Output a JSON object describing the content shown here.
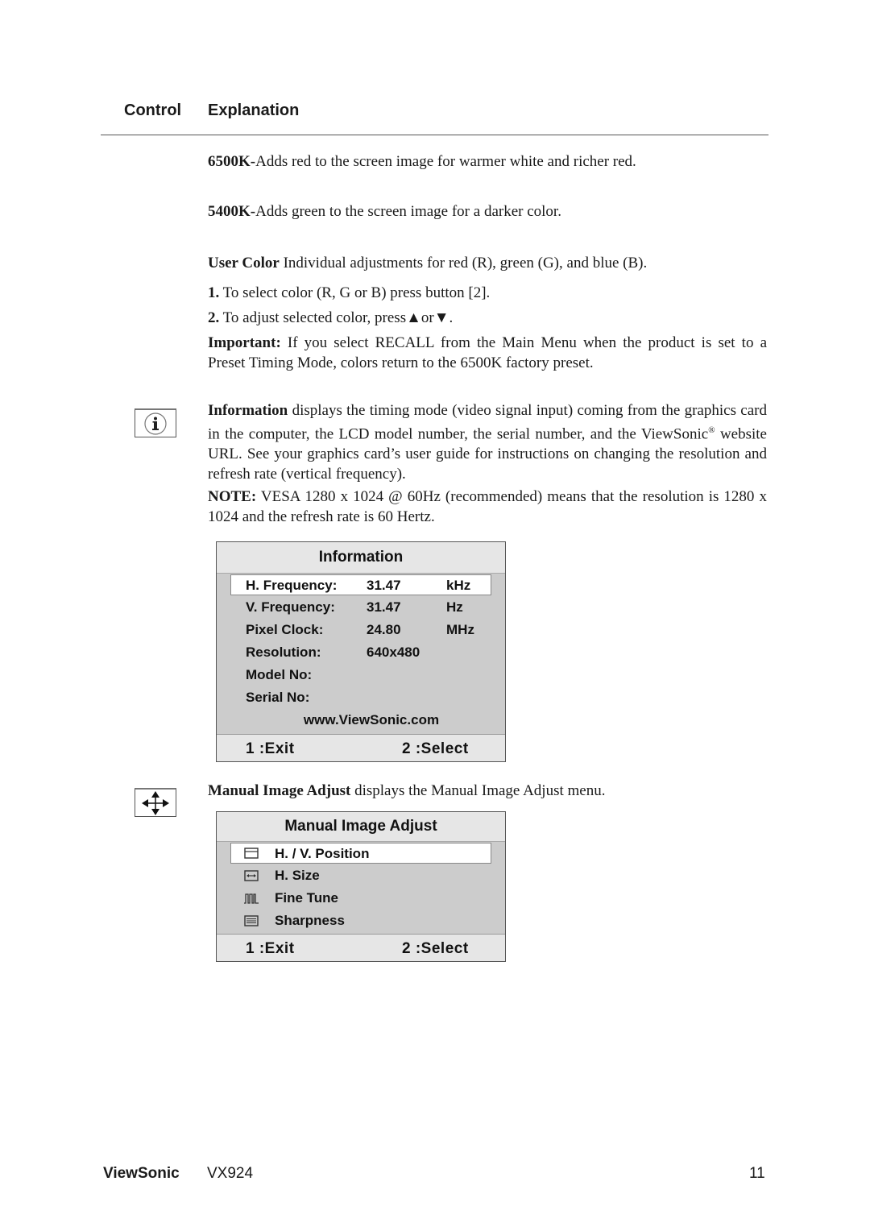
{
  "header": {
    "control": "Control",
    "explanation": "Explanation"
  },
  "color_temps": [
    {
      "key": "6500K-",
      "text": "Adds red to the screen image for warmer white and richer red."
    },
    {
      "key": "5400K-",
      "text": "Adds green to the screen image for a darker color."
    }
  ],
  "user_color": {
    "key": "User Color",
    "text": " Individual adjustments for red (R), green (G),  and blue (B).",
    "steps": [
      {
        "num": "1.",
        "text": " To select color (R, G or B) press button [2]."
      },
      {
        "num": "2.",
        "text_before": " To adjust selected color, press",
        "up": "▲",
        "or": "or",
        "down": "▼",
        "text_after": "."
      }
    ],
    "important_key": "Important:",
    "important_text": " If you select RECALL from the Main Menu when the product is set to a Preset Timing Mode, colors return to the 6500K factory preset."
  },
  "information": {
    "icon": "info-icon",
    "key": "Information",
    "text": " displays the timing mode (video signal input) coming from the graphics card in the computer, the LCD model number, the serial number, and the ViewSonic",
    "reg": "®",
    "text2": " website URL. See your graphics card’s user guide for instructions on changing the resolution and refresh rate (vertical frequency).",
    "note_key": "NOTE:",
    "note_text": " VESA 1280 x 1024 @ 60Hz (recommended) means that the resolution is 1280 x 1024 and the refresh rate is 60 Hertz."
  },
  "info_osd": {
    "title": "Information",
    "rows": [
      {
        "label": "H. Frequency:",
        "value": "31.47",
        "unit": "kHz",
        "selected": true
      },
      {
        "label": "V. Frequency:",
        "value": "31.47",
        "unit": "Hz"
      },
      {
        "label": "Pixel Clock:",
        "value": "24.80",
        "unit": "MHz"
      },
      {
        "label": "Resolution:",
        "value": "640x480",
        "unit": ""
      },
      {
        "label": "Model No:",
        "value": "",
        "unit": ""
      },
      {
        "label": "Serial No:",
        "value": "",
        "unit": ""
      }
    ],
    "url": "www.ViewSonic.com",
    "exit": "1 :Exit",
    "select": "2 :Select"
  },
  "manual_adjust": {
    "icon": "four-way-arrows-icon",
    "key": "Manual Image Adjust",
    "text": " displays the Manual Image Adjust menu."
  },
  "manual_osd": {
    "title": "Manual Image Adjust",
    "items": [
      {
        "icon": "position-icon",
        "label": "H. / V. Position",
        "selected": true
      },
      {
        "icon": "h-size-icon",
        "label": "H. Size"
      },
      {
        "icon": "fine-tune-icon",
        "label": "Fine Tune"
      },
      {
        "icon": "sharpness-icon",
        "label": "Sharpness"
      }
    ],
    "exit": "1 :Exit",
    "select": "2 :Select"
  },
  "footer": {
    "brand": "ViewSonic",
    "model": "VX924",
    "page": "11"
  }
}
